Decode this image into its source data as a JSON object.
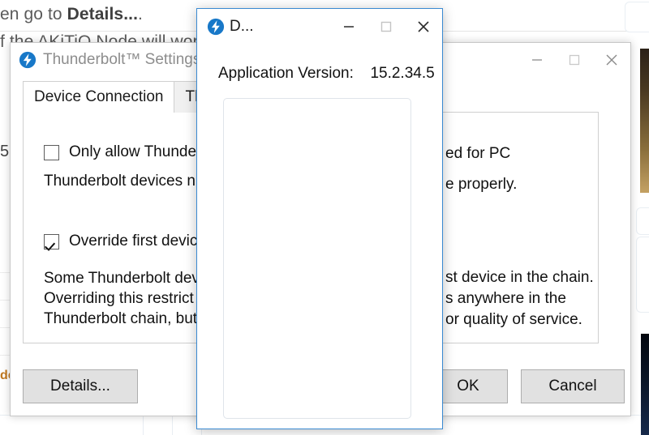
{
  "background": {
    "line1_prefix": "en go to ",
    "line1_bold": "Details...",
    "line1_suffix": ".",
    "line2": "f the AKiTiO Node will work",
    "left_marker": "5",
    "left_label": "de"
  },
  "settings_window": {
    "title": "Thunderbolt™ Settings",
    "icon": "thunderbolt-icon",
    "controls": {
      "minimize": "minimize-icon",
      "maximize": "maximize-icon",
      "close": "close-icon"
    },
    "tabs": [
      {
        "label": "Device Connection",
        "active": true
      },
      {
        "label": "Thu",
        "active": false
      }
    ],
    "options": [
      {
        "label": "Only allow Thunder",
        "checked": false,
        "description_left": "Thunderbolt devices n",
        "description_right_line1": "ed for PC",
        "description_right_line2": "e properly."
      },
      {
        "label": "Override first device",
        "checked": true,
        "paragraph_left": "Some Thunderbolt dev\nOverriding this restrict\nThunderbolt chain, but",
        "paragraph_right": "st device in the chain.\ns anywhere in the\nor quality of service."
      }
    ],
    "buttons": {
      "details": "Details...",
      "ok": "OK",
      "cancel": "Cancel"
    }
  },
  "details_dialog": {
    "title": "D...",
    "icon": "thunderbolt-icon",
    "version_label": "Application Version:",
    "version_value": "15.2.34.5",
    "controls": {
      "minimize": "minimize-icon",
      "maximize": "maximize-icon",
      "close": "close-icon"
    },
    "list_items": []
  },
  "colors": {
    "accent_blue": "#3a8ad2",
    "tb_icon_blue": "#1878c8",
    "title_gray": "#8d8d8d",
    "button_face": "#e1e1e1"
  }
}
